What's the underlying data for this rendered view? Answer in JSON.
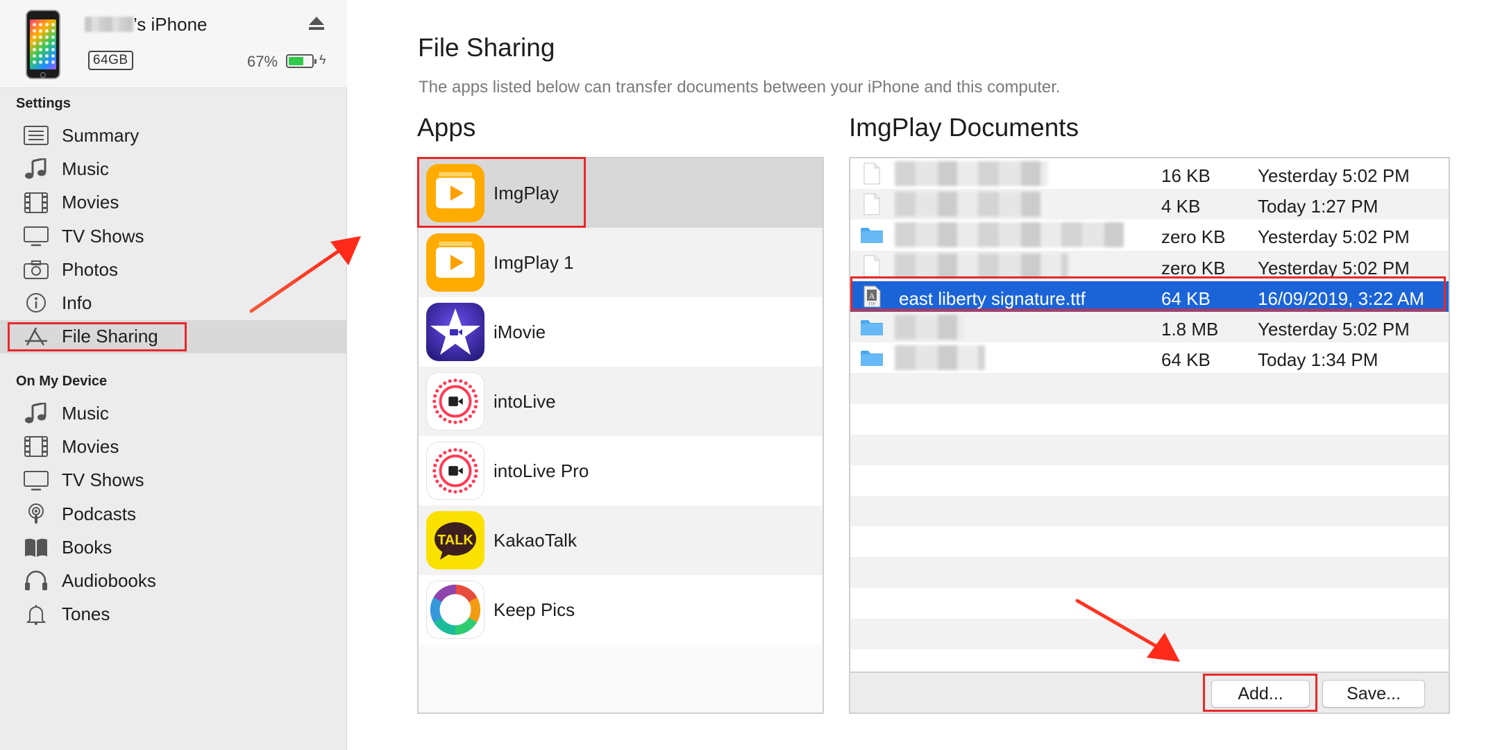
{
  "device": {
    "name_suffix": "’s iPhone",
    "capacity": "64GB",
    "battery_percent": "67%",
    "battery_level": 0.67
  },
  "sidebar": {
    "settings_title": "Settings",
    "settings_items": [
      {
        "label": "Summary",
        "icon": "summary-icon"
      },
      {
        "label": "Music",
        "icon": "music-note-icon"
      },
      {
        "label": "Movies",
        "icon": "film-icon"
      },
      {
        "label": "TV Shows",
        "icon": "tv-icon"
      },
      {
        "label": "Photos",
        "icon": "camera-icon"
      },
      {
        "label": "Info",
        "icon": "info-icon"
      },
      {
        "label": "File Sharing",
        "icon": "app-store-icon",
        "selected": true
      }
    ],
    "device_title": "On My Device",
    "device_items": [
      {
        "label": "Music",
        "icon": "music-note-icon"
      },
      {
        "label": "Movies",
        "icon": "film-icon"
      },
      {
        "label": "TV Shows",
        "icon": "tv-icon"
      },
      {
        "label": "Podcasts",
        "icon": "podcast-icon"
      },
      {
        "label": "Books",
        "icon": "book-icon"
      },
      {
        "label": "Audiobooks",
        "icon": "headphones-icon"
      },
      {
        "label": "Tones",
        "icon": "bell-icon"
      }
    ]
  },
  "main": {
    "title": "File Sharing",
    "subtitle": "The apps listed below can transfer documents between your iPhone and this computer.",
    "apps_title": "Apps",
    "docs_title": "ImgPlay Documents"
  },
  "apps": [
    {
      "name": "ImgPlay",
      "icon": "imgplay-icon",
      "selected": true
    },
    {
      "name": "ImgPlay 1",
      "icon": "imgplay-icon"
    },
    {
      "name": "iMovie",
      "icon": "imovie-icon"
    },
    {
      "name": "intoLive",
      "icon": "intolive-icon"
    },
    {
      "name": "intoLive Pro",
      "icon": "intolive-icon"
    },
    {
      "name": "KakaoTalk",
      "icon": "kakaotalk-icon"
    },
    {
      "name": "Keep Pics",
      "icon": "keeppics-icon"
    }
  ],
  "kakao_icon_text": "TALK",
  "documents": [
    {
      "name": "",
      "type": "file",
      "size": "16 KB",
      "date": "Yesterday 5:02 PM"
    },
    {
      "name": "",
      "type": "file",
      "size": "4 KB",
      "date": "Today 1:27 PM"
    },
    {
      "name": "",
      "type": "folder",
      "size": "zero KB",
      "date": "Yesterday 5:02 PM"
    },
    {
      "name": "",
      "type": "file",
      "size": "zero KB",
      "date": "Yesterday 5:02 PM"
    },
    {
      "name": "east liberty signature.ttf",
      "type": "font",
      "size": "64 KB",
      "date": "16/09/2019, 3:22 AM",
      "selected": true
    },
    {
      "name": "",
      "type": "folder",
      "size": "1.8 MB",
      "date": "Yesterday 5:02 PM"
    },
    {
      "name": "",
      "type": "folder",
      "size": "64 KB",
      "date": "Today 1:34 PM"
    }
  ],
  "buttons": {
    "add": "Add...",
    "save": "Save..."
  },
  "colors": {
    "highlight": "#e8282a",
    "selection": "#1b64d8",
    "battery": "#31c94a"
  }
}
